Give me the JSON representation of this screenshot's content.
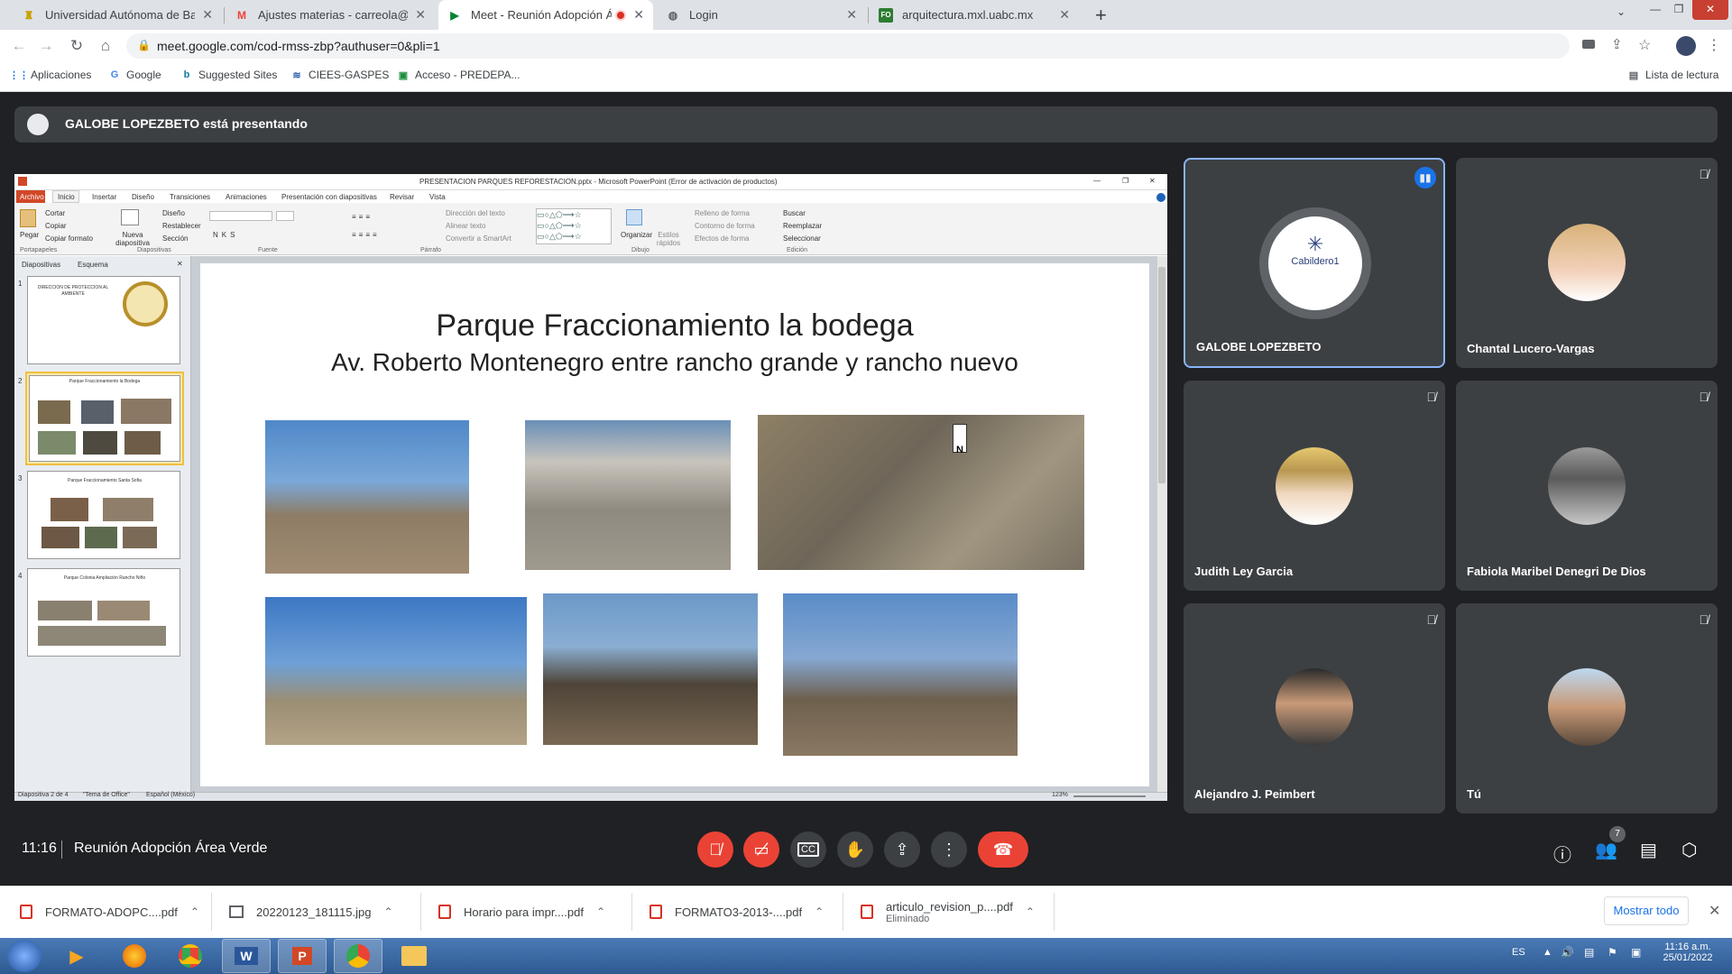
{
  "browser": {
    "tabs": [
      {
        "title": "Universidad Autónoma de Baja C",
        "active": false
      },
      {
        "title": "Ajustes materias - carreola@uabc",
        "active": false
      },
      {
        "title": "Meet - Reunión Adopción Á",
        "active": true
      },
      {
        "title": "Login",
        "active": false
      },
      {
        "title": "arquitectura.mxl.uabc.mx",
        "active": false
      }
    ],
    "url": "meet.google.com/cod-rmss-zbp?authuser=0&pli=1",
    "bookmarks": [
      "Aplicaciones",
      "Google",
      "Suggested Sites",
      "CIEES-GASPES",
      "Acceso - PREDEPA..."
    ],
    "reading_list": "Lista de lectura"
  },
  "meet": {
    "presenting_banner": "GALOBE LOPEZBETO está presentando",
    "time": "11:16",
    "meeting_name": "Reunión Adopción Área Verde",
    "participants_count": "7",
    "participants": [
      {
        "name": "GALOBE LOPEZBETO",
        "avatar_text": "Cabildero1",
        "speaking": true,
        "muted": false
      },
      {
        "name": "Chantal Lucero-Vargas",
        "muted": true
      },
      {
        "name": "Judith Ley Garcia",
        "muted": true
      },
      {
        "name": "Fabiola Maribel Denegri De Dios",
        "muted": true
      },
      {
        "name": "Alejandro J. Peimbert",
        "muted": true
      },
      {
        "name": "Tú",
        "muted": true
      }
    ]
  },
  "ppt": {
    "window_title": "PRESENTACION PARQUES REFORESTACION.pptx - Microsoft PowerPoint (Error de activación de productos)",
    "ribbon_tabs": [
      "Archivo",
      "Inicio",
      "Insertar",
      "Diseño",
      "Transiciones",
      "Animaciones",
      "Presentación con diapositivas",
      "Revisar",
      "Vista"
    ],
    "groups": [
      "Portapapeles",
      "Diapositivas",
      "Fuente",
      "Párrafo",
      "Dibujo",
      "Edición"
    ],
    "clipboard": [
      "Cortar",
      "Copiar",
      "Copiar formato"
    ],
    "paste": "Pegar",
    "new_slide": "Nueva diapositiva",
    "slides_cmds": [
      "Diseño",
      "Restablecer",
      "Sección"
    ],
    "paragraph_cmds": [
      "Dirección del texto",
      "Alinear texto",
      "Convertir a SmartArt"
    ],
    "drawing_cmds": [
      "Organizar",
      "Estilos rápidos"
    ],
    "shape_cmds": [
      "Relleno de forma",
      "Contorno de forma",
      "Efectos de forma"
    ],
    "edit_cmds": [
      "Buscar",
      "Reemplazar",
      "Seleccionar"
    ],
    "panel_tabs": [
      "Diapositivas",
      "Esquema"
    ],
    "slide_title": "Parque  Fraccionamiento la bodega",
    "slide_subtitle": "Av. Roberto Montenegro entre rancho grande y rancho nuevo",
    "status": [
      "Diapositiva 2 de 4",
      "\"Tema de Office\"",
      "Español (México)"
    ],
    "zoom": "123%",
    "thumbs": [
      {
        "num": "1",
        "text": "DIRECCION DE PROTECCION AL AMBIENTE"
      },
      {
        "num": "2",
        "text": "Parque Fraccionamiento la Bodega"
      },
      {
        "num": "3",
        "text": "Parque Fraccionamiento Santa Sofia"
      },
      {
        "num": "4",
        "text": "Parque Colonia Ampliación Rancho Niño"
      }
    ]
  },
  "downloads": {
    "items": [
      {
        "name": "FORMATO-ADOPC....pdf",
        "sub": ""
      },
      {
        "name": "20220123_181115.jpg",
        "sub": ""
      },
      {
        "name": "Horario para impr....pdf",
        "sub": ""
      },
      {
        "name": "FORMATO3-2013-....pdf",
        "sub": ""
      },
      {
        "name": "articulo_revision_p....pdf",
        "sub": "Eliminado"
      }
    ],
    "show_all": "Mostrar todo"
  },
  "taskbar": {
    "lang": "ES",
    "time": "11:16 a.m.",
    "date": "25/01/2022"
  }
}
